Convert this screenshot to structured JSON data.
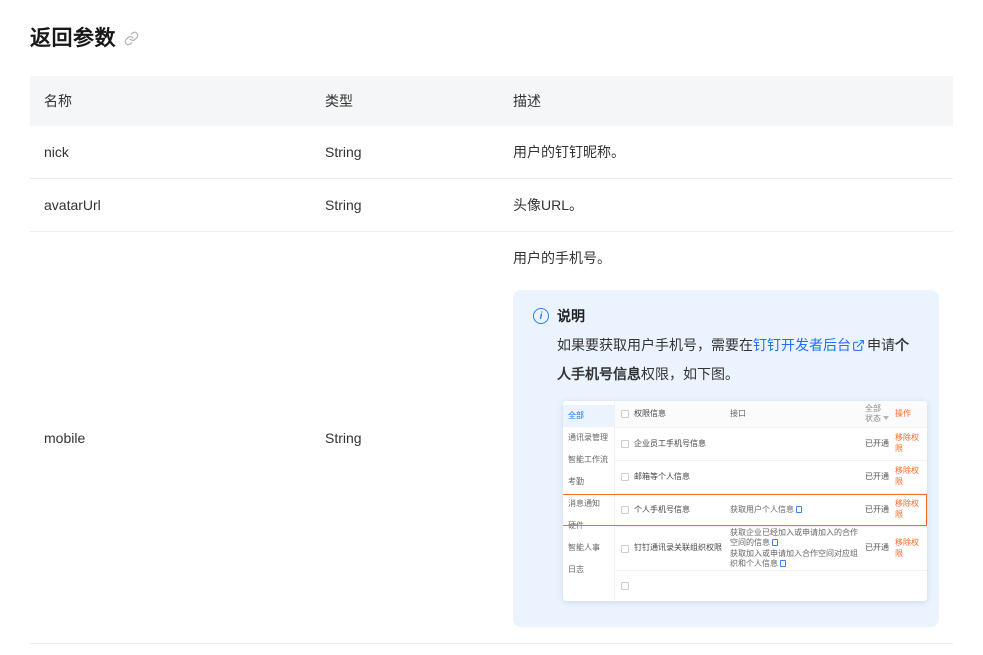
{
  "colors": {
    "link_blue": "#1f6ffb",
    "note_bg": "#eaf3fe",
    "highlight_orange": "#ff6a2b",
    "table_header_bg": "#f5f6f7"
  },
  "icons": {
    "anchor": "link-icon",
    "info": "info-icon",
    "external": "external-link-icon",
    "filter": "filter-icon",
    "api_doc": "doc-icon"
  },
  "page": {
    "title": "返回参数"
  },
  "params_table": {
    "headers": {
      "name": "名称",
      "type": "类型",
      "desc": "描述"
    },
    "rows": [
      {
        "name": "nick",
        "type": "String",
        "desc": "用户的钉钉昵称。"
      },
      {
        "name": "avatarUrl",
        "type": "String",
        "desc": "头像URL。"
      },
      {
        "name": "mobile",
        "type": "String",
        "desc": "用户的手机号。"
      }
    ]
  },
  "note": {
    "title": "说明",
    "text1": "如果要获取用户手机号，需要在",
    "link_text": "钉钉开发者后台",
    "text2": "申请",
    "bold_text": "个人手机号信息",
    "text3": "权限，如下图。"
  },
  "screenshot": {
    "sidebar": [
      "全部",
      "通讯录管理",
      "智能工作流",
      "考勤",
      "消息通知",
      "硬件",
      "智能人事",
      "日志"
    ],
    "table": {
      "headers": {
        "permission": "权限信息",
        "api": "接口",
        "status_line1": "全部",
        "status_line2": "状态",
        "action": "操作"
      },
      "rows": [
        {
          "permission": "企业员工手机号信息",
          "status": "已开通",
          "action": "移除权限"
        },
        {
          "permission": "邮箱等个人信息",
          "status": "已开通",
          "action": "移除权限"
        },
        {
          "permission": "个人手机号信息",
          "api1": "获取用户个人信息",
          "status": "已开通",
          "action": "移除权限"
        },
        {
          "permission": "钉钉通讯录关联组织权限",
          "api1": "获取企业已经加入或申请加入的合作空间的信息",
          "api2": "获取加入或申请加入合作空间对应组织和个人信息",
          "status": "已开通",
          "action": "移除权限"
        }
      ]
    }
  }
}
